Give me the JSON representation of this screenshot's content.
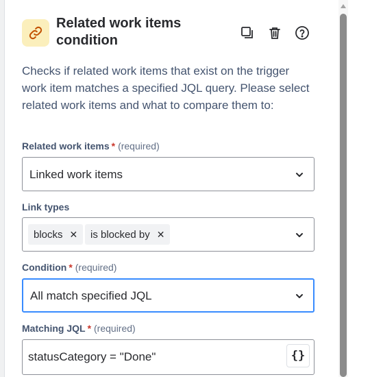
{
  "header": {
    "title": "Related work items condition",
    "icon": "link-icon",
    "actions": [
      "duplicate-icon",
      "delete-icon",
      "help-icon"
    ]
  },
  "description": "Checks if related work items that exist on the trigger work item matches a specified JQL query. Please select related work items and what to compare them to:",
  "fields": {
    "related": {
      "label": "Related work items",
      "required_star": "*",
      "required_text": "(required)",
      "value": "Linked work items"
    },
    "link_types": {
      "label": "Link types",
      "chips": [
        "blocks",
        "is blocked by"
      ]
    },
    "condition": {
      "label": "Condition",
      "required_star": "*",
      "required_text": "(required)",
      "value": "All match specified JQL"
    },
    "jql": {
      "label": "Matching JQL",
      "required_star": "*",
      "required_text": "(required)",
      "value": "statusCategory = \"Done\"",
      "button_label": "{}"
    }
  },
  "colors": {
    "accent": "#388bff",
    "icon_bg": "#fbefbc",
    "required": "#c9372c"
  }
}
